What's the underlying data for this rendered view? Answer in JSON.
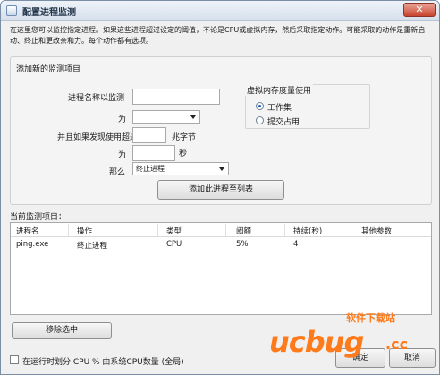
{
  "window": {
    "title": "配置进程监测",
    "close_label": "✕"
  },
  "description": "在这里您可以监控指定进程。如果这些进程超过设定的阈值，不论是CPU或虚拟内存，然后采取指定动作。可能采取的动作是重新启动、终止和更改亲和力。每个动作都有选项。",
  "add_group": {
    "title": "添加新的监测项目",
    "process_name_label": "进程名称以监测",
    "process_name_value": "",
    "for_label": "为",
    "for_value": "",
    "exceed_label": "并且如果发现使用超过",
    "exceed_value": "",
    "percent_unit": "兆字节",
    "for2_label": "为",
    "duration_value": "",
    "seconds_unit": "秒",
    "then_label": "那么",
    "action_value": "终止进程",
    "add_button": "添加此进程至列表",
    "vm_group": {
      "title": "虚拟内存度量使用",
      "option_working_set": "工作集",
      "option_commit": "提交占用",
      "selected": "工作集"
    }
  },
  "monitor_list": {
    "label": "当前监测项目：",
    "columns": [
      "进程名",
      "操作",
      "类型",
      "阈额",
      "持续(秒)",
      "其他参数"
    ],
    "rows": [
      [
        "ping.exe",
        "终止进程",
        "CPU",
        "5%",
        "4",
        ""
      ]
    ]
  },
  "remove_button": "移除选中",
  "cpu_checkbox": {
    "label": "在运行时划分 CPU % 由系统CPU数量 (全局)",
    "checked": false
  },
  "ok_button": "确定",
  "cancel_button": "取消",
  "watermark": {
    "brand": "ucbug",
    "cn": "软件下载站",
    "tld": ".cc"
  }
}
